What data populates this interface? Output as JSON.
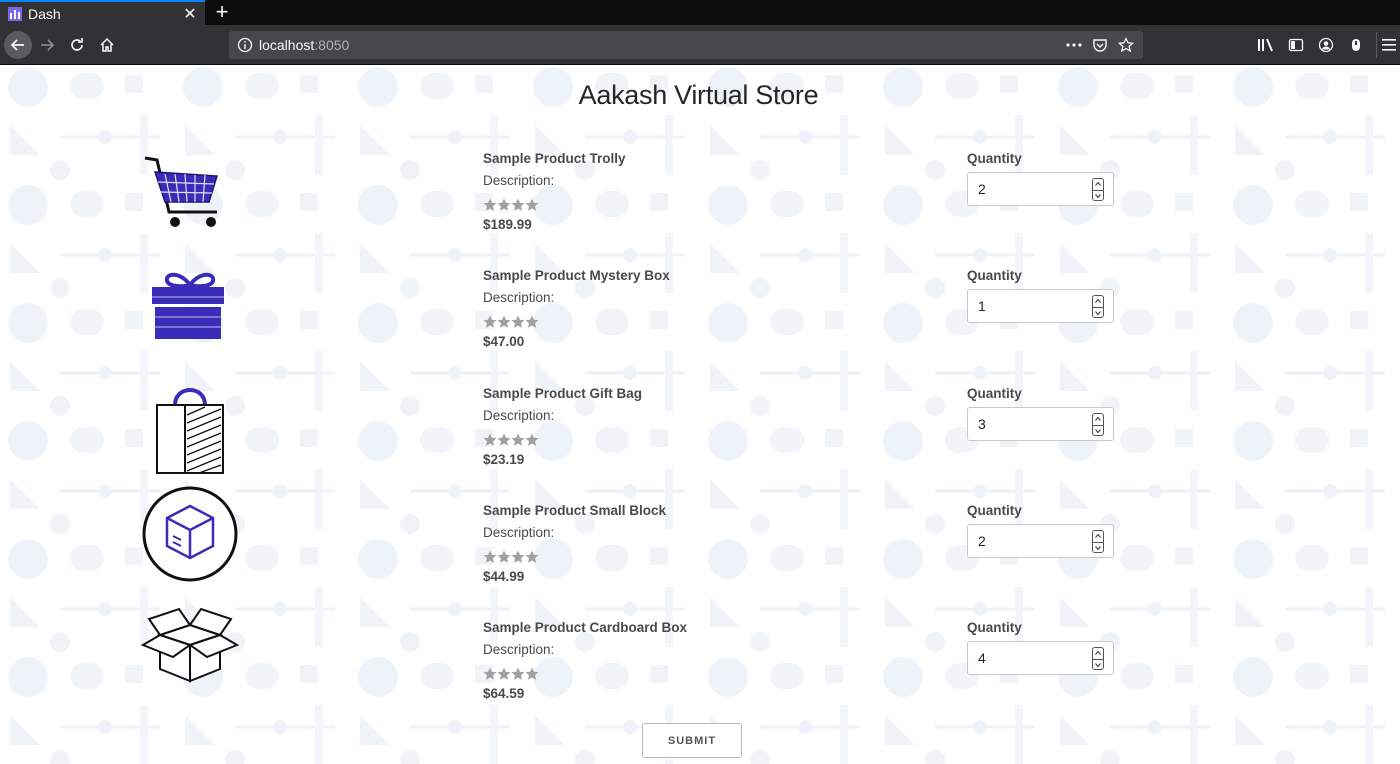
{
  "browser": {
    "tab_title": "Dash",
    "new_tab_symbol": "+",
    "url_host": "localhost",
    "url_port": ":8050",
    "icons": [
      "back-icon",
      "forward-icon",
      "reload-icon",
      "home-icon",
      "info-icon",
      "more-icon",
      "pocket-icon",
      "bookmark-star-icon",
      "library-icon",
      "sidebar-icon",
      "account-icon",
      "extension-icon",
      "menu-icon"
    ]
  },
  "store": {
    "title": "Aakash Virtual Store",
    "quantity_label": "Quantity",
    "submit_label": "SUBMIT",
    "products": [
      {
        "name": "Sample Product Trolly",
        "description": "Description:",
        "rating": 4,
        "price": "$189.99",
        "quantity": "2",
        "image": "shopping-cart-icon"
      },
      {
        "name": "Sample Product Mystery Box",
        "description": "Description:",
        "rating": 4,
        "price": "$47.00",
        "quantity": "1",
        "image": "gift-box-icon"
      },
      {
        "name": "Sample Product Gift Bag",
        "description": "Description:",
        "rating": 4,
        "price": "$23.19",
        "quantity": "3",
        "image": "gift-bag-icon"
      },
      {
        "name": "Sample Product Small Block",
        "description": "Description:",
        "rating": 4,
        "price": "$44.99",
        "quantity": "2",
        "image": "cube-circle-icon"
      },
      {
        "name": "Sample Product Cardboard Box",
        "description": "Description:",
        "rating": 4,
        "price": "$64.59",
        "quantity": "4",
        "image": "open-box-icon"
      }
    ]
  },
  "colors": {
    "accent": "#0a84ff",
    "product_blue": "#3a2bb8",
    "star_gray": "#a39f9f",
    "pattern": "#eef3f9"
  }
}
